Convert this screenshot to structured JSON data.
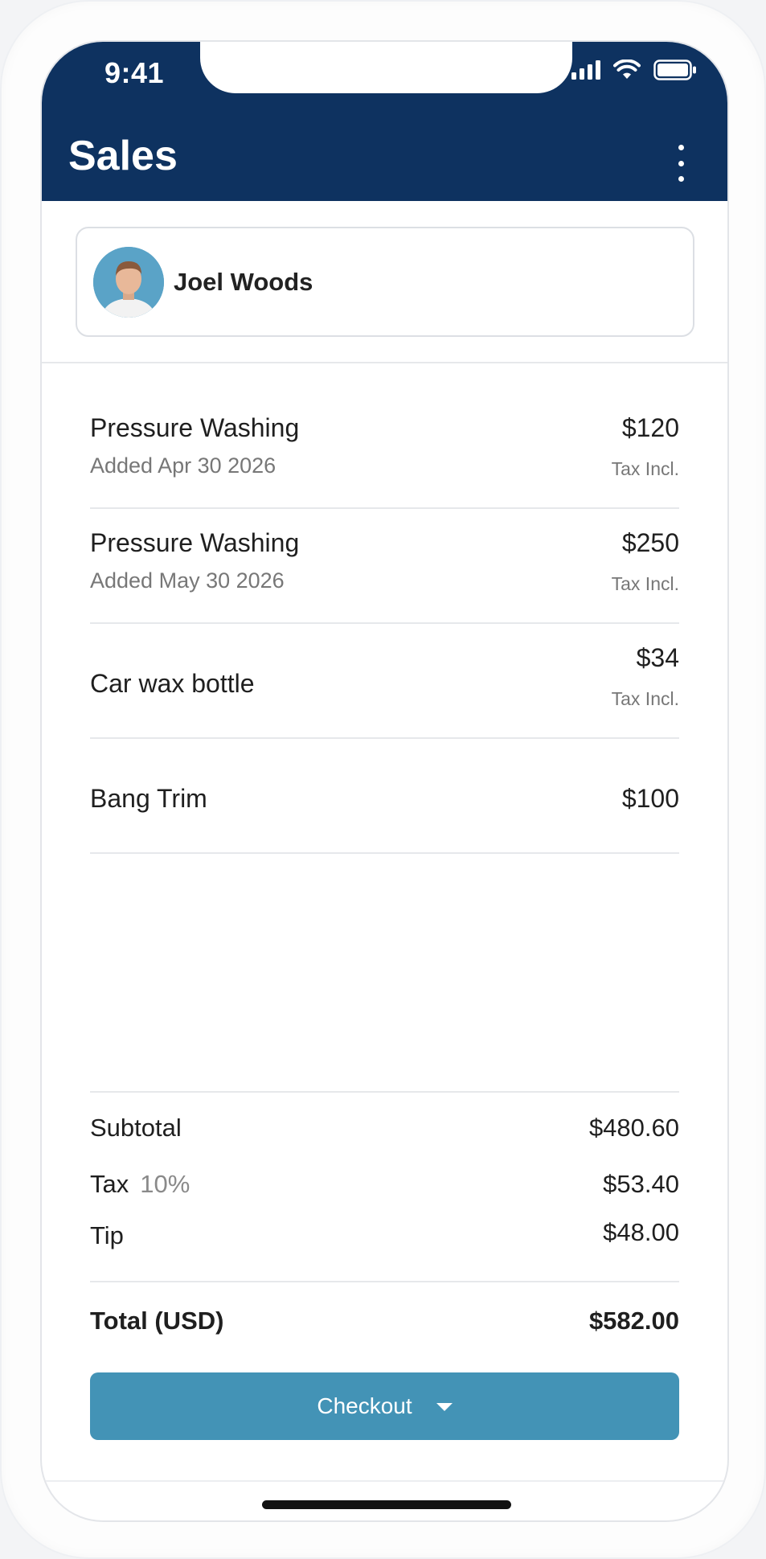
{
  "status_bar": {
    "time": "9:41"
  },
  "header": {
    "title": "Sales"
  },
  "customer": {
    "name": "Joel Woods"
  },
  "items": [
    {
      "name": "Pressure Washing",
      "date": "Added Apr 30 2026",
      "price": "$120",
      "tax_note": "Tax Incl."
    },
    {
      "name": "Pressure Washing",
      "date": "Added May 30 2026",
      "price": "$250",
      "tax_note": "Tax Incl."
    },
    {
      "name": "Car wax bottle",
      "price": "$34",
      "tax_note": "Tax Incl."
    },
    {
      "name": "Bang Trim",
      "price": "$100"
    }
  ],
  "totals": {
    "subtotal_label": "Subtotal",
    "subtotal_value": "$480.60",
    "tax_label": "Tax",
    "tax_rate": "10%",
    "tax_value": "$53.40",
    "tip_label": "Tip",
    "tip_value": "$48.00",
    "total_label": "Total (USD)",
    "total_value": "$582.00"
  },
  "checkout": {
    "label": "Checkout"
  },
  "colors": {
    "header_bg": "#0e3260",
    "checkout_bg": "#4393b6",
    "avatar_bg": "#5aa3c7"
  }
}
